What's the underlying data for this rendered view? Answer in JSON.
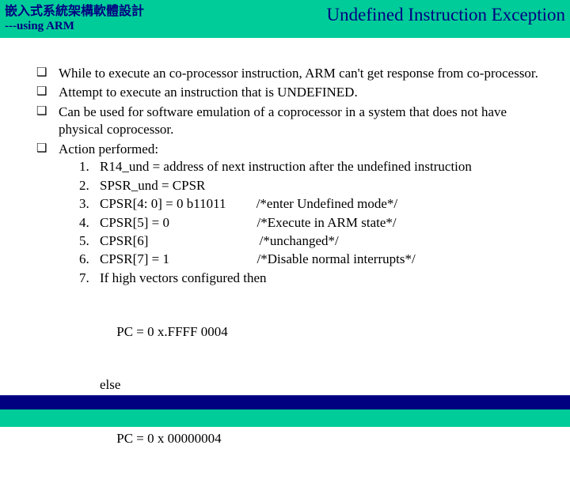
{
  "header": {
    "title_cn": "嵌入式系統架構軟體設計",
    "subtitle": "---using ARM",
    "title_right": "Undefined Instruction Exception"
  },
  "bullets": {
    "b1": "While to execute an co-processor instruction, ARM can't get response from co-processor.",
    "b2": "Attempt to execute an instruction that is UNDEFINED.",
    "b3": "Can be used for software emulation of a coprocessor in a system that does not have physical coprocessor.",
    "b4": "Action performed:"
  },
  "steps": {
    "n1": "1.",
    "t1": "R14_und = address of next instruction after the undefined instruction",
    "n2": "2.",
    "t2": "SPSR_und = CPSR",
    "n3": "3.",
    "t3": "CPSR[4: 0] = 0 b11011         /*enter Undefined mode*/",
    "n4": "4.",
    "t4": "CPSR[5] = 0                          /*Execute in ARM state*/",
    "n5": "5.",
    "t5": "CPSR[6]                                 /*unchanged*/",
    "n6": "6.",
    "t6": "CPSR[7] = 1                          /*Disable normal interrupts*/",
    "n7": "7.",
    "t7": "If high vectors configured then"
  },
  "ifblock": {
    "l1": "     PC = 0 x.FFFF 0004",
    "l2": "else",
    "l3": "     PC = 0 x 00000004"
  }
}
